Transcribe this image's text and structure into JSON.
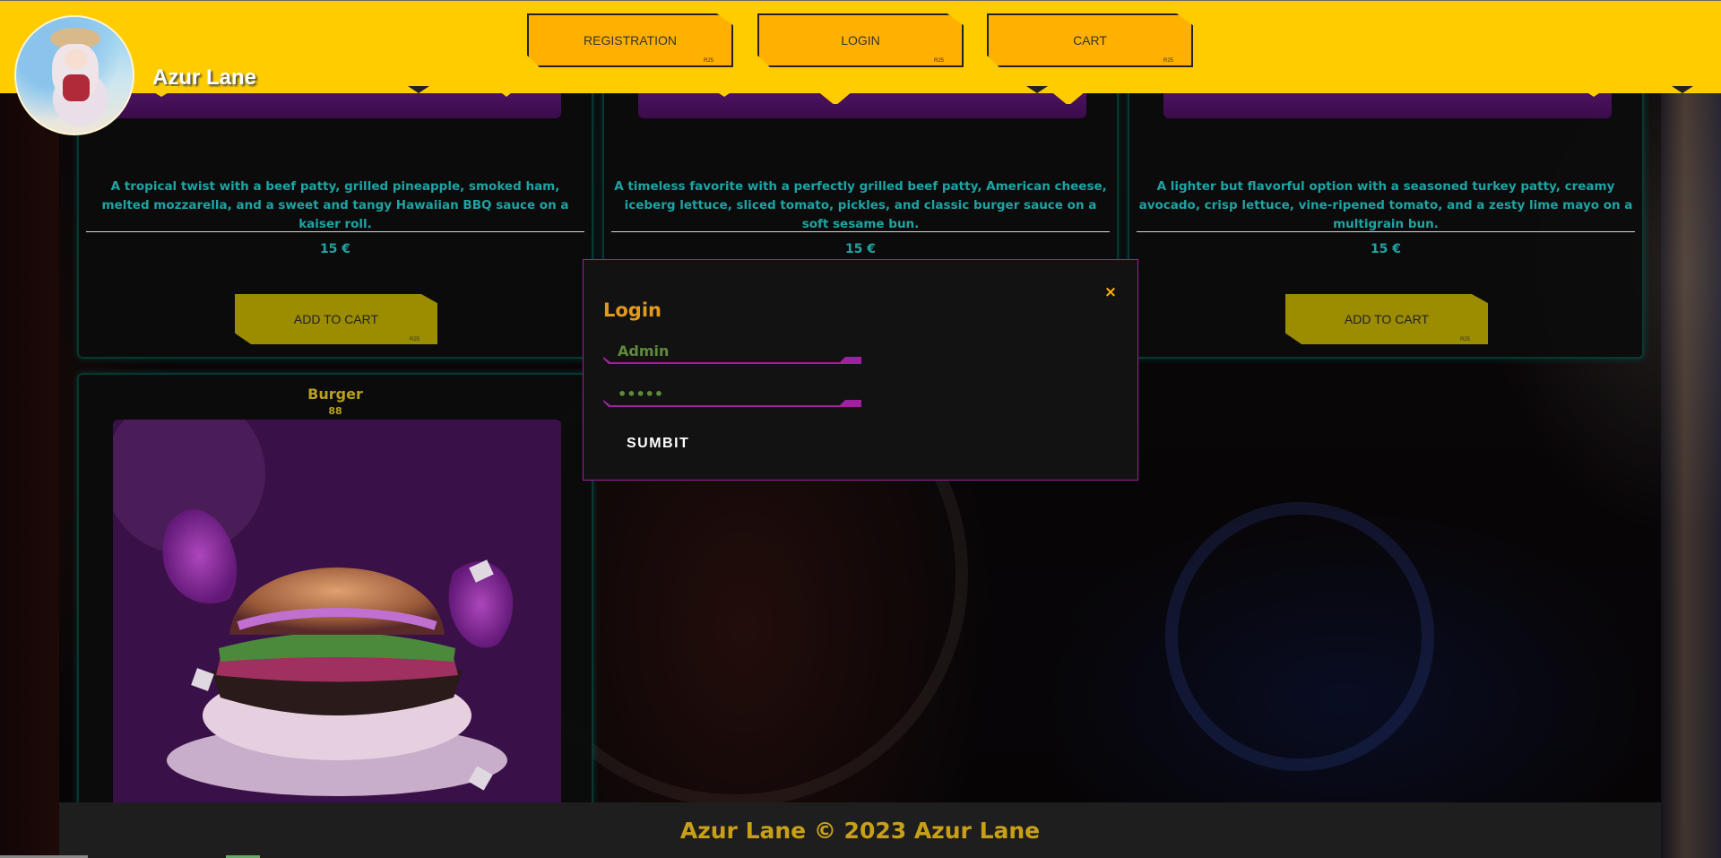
{
  "header": {
    "site_title": "Azur Lane",
    "nav": {
      "registration": "REGISTRATION",
      "login": "LOGIN",
      "cart": "CART",
      "tag": "R25"
    }
  },
  "products": [
    {
      "description": "A tropical twist with a beef patty, grilled pineapple, smoked ham, melted mozzarella, and a sweet and tangy Hawaiian BBQ sauce on a kaiser roll.",
      "price": "15 €",
      "button": "ADD TO CART"
    },
    {
      "description": "A timeless favorite with a perfectly grilled beef patty, American cheese, iceberg lettuce, sliced tomato, pickles, and classic burger sauce on a soft sesame bun.",
      "price": "15 €"
    },
    {
      "description": "A lighter but flavorful option with a seasoned turkey patty, creamy avocado, crisp lettuce, vine-ripened tomato, and a zesty lime mayo on a multigrain bun.",
      "price": "15 €",
      "button": "ADD TO CART"
    },
    {
      "title": "Burger",
      "subtitle": "88"
    }
  ],
  "modal": {
    "title": "Login",
    "close": "×",
    "username_value": "Admin",
    "password_value": "•••••",
    "submit": "SUMBIT"
  },
  "footer": {
    "text": "Azur Lane © 2023 Azur Lane"
  },
  "colors": {
    "header": "#ffcc00",
    "nav_button": "#ffb000",
    "accent_teal": "#1fa3a3",
    "modal_border": "#a020a0",
    "add_to_cart": "#9b8c00",
    "footer_text": "#c8a018"
  },
  "icons": {
    "close": "close-icon"
  }
}
